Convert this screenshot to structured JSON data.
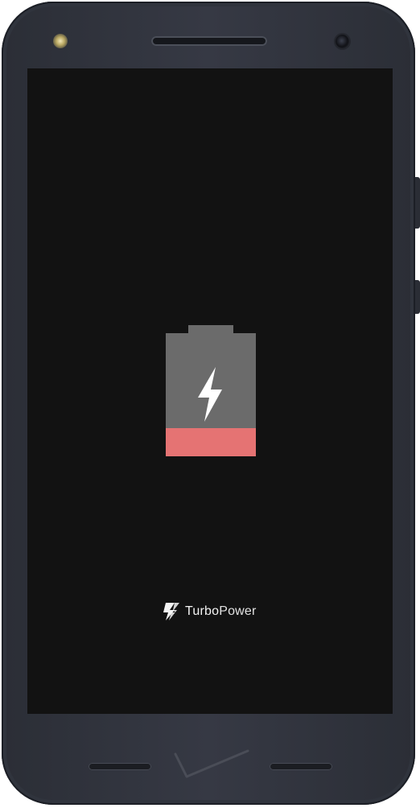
{
  "device": {
    "model": "phone"
  },
  "screen": {
    "background_color": "#121212",
    "battery": {
      "charging_icon": "lightning-bolt-icon",
      "body_color": "#6b6b6b",
      "level_color": "#e57373"
    },
    "brand": {
      "logo_icon": "turbopower-logo-icon",
      "name_part1": "Turbo",
      "name_part2": "Power"
    }
  },
  "bezel": {
    "carrier_logo_icon": "verizon-check-logo-icon"
  }
}
